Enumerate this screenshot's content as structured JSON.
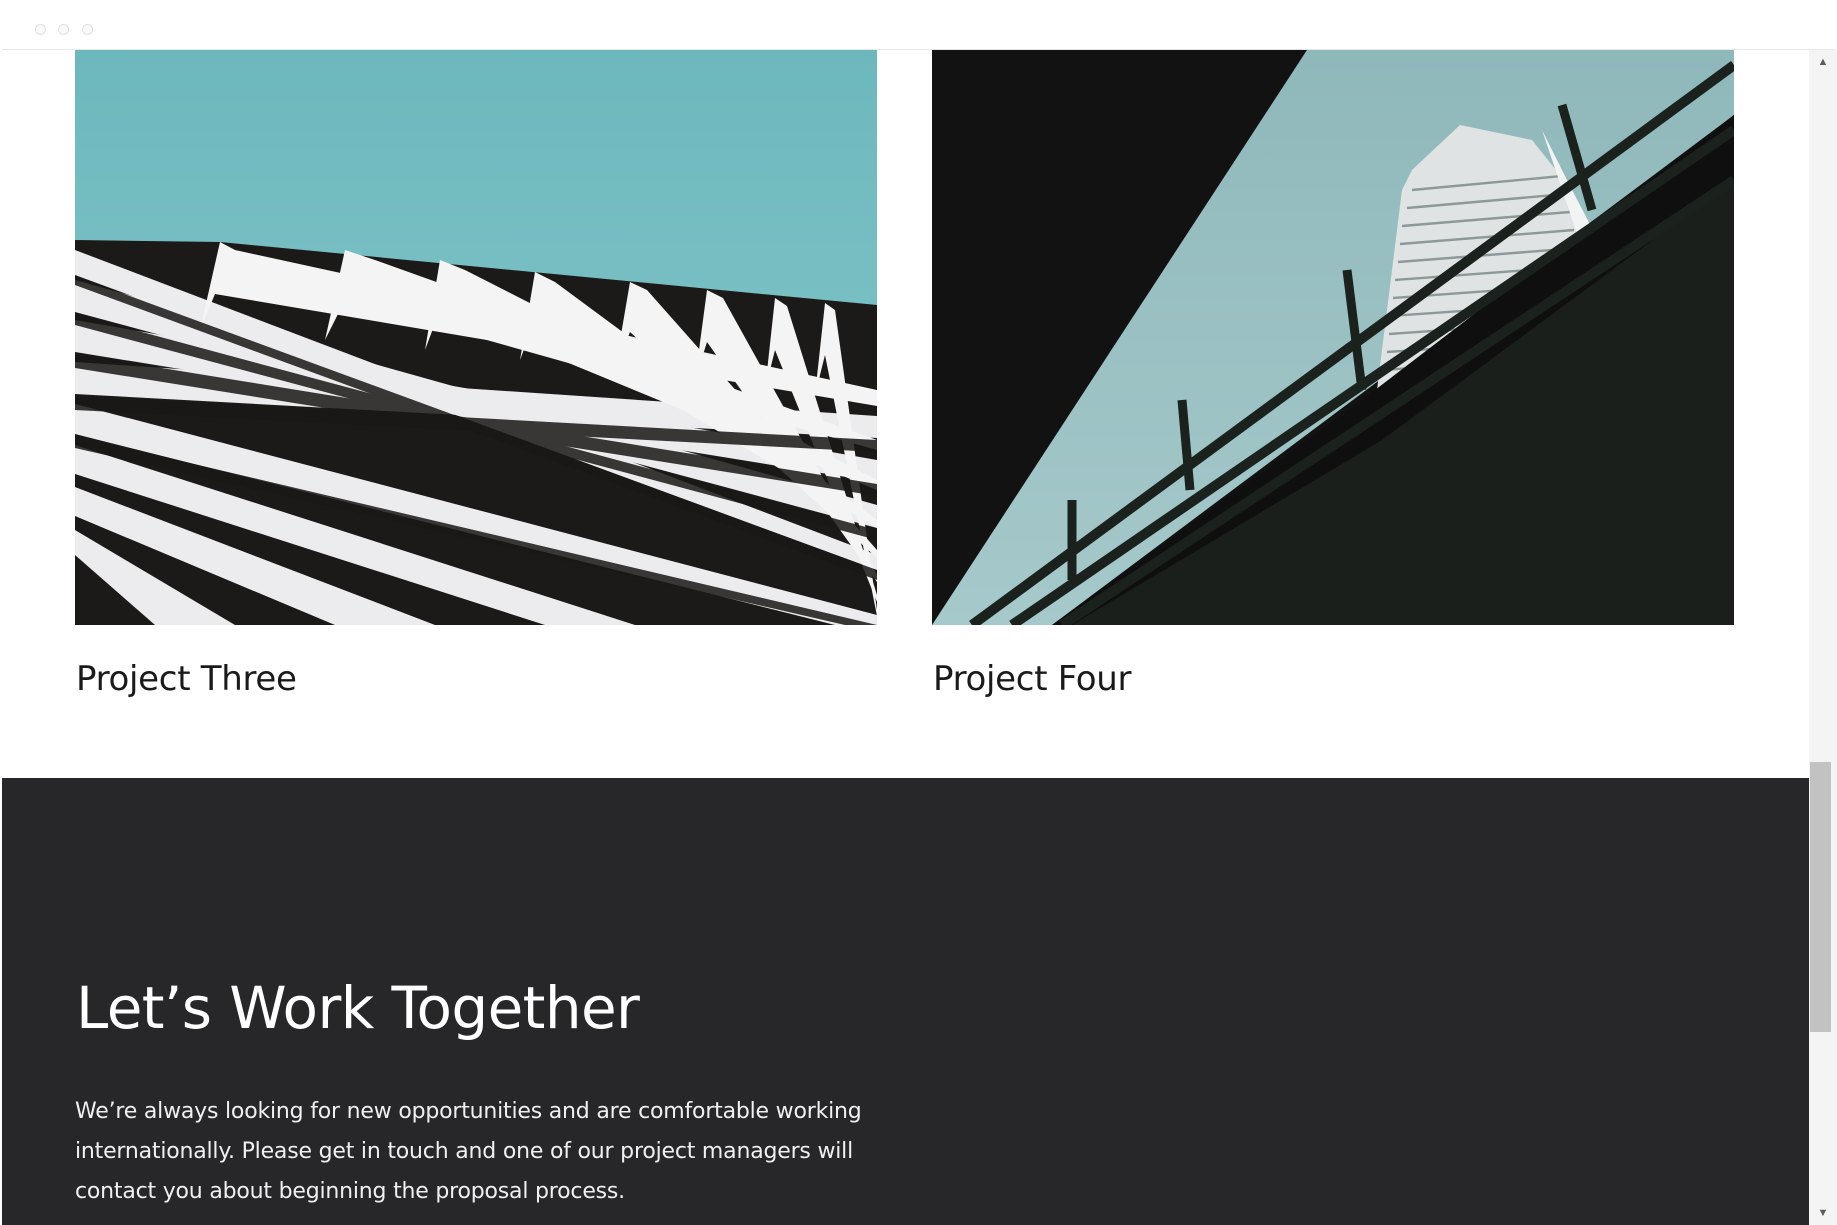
{
  "projects": [
    {
      "title": "Project Three"
    },
    {
      "title": "Project Four"
    }
  ],
  "contact": {
    "heading": "Let’s Work Together",
    "body": "We’re always looking for new opportunities and are comfortable working internationally. Please get in touch and one of our project managers will contact you about beginning the proposal process."
  },
  "scrollbar": {
    "up_icon": "▲",
    "down_icon": "▼"
  },
  "colors": {
    "sky": "#79bfc3",
    "dark_section": "#272729",
    "page_background": "#ffffff"
  }
}
